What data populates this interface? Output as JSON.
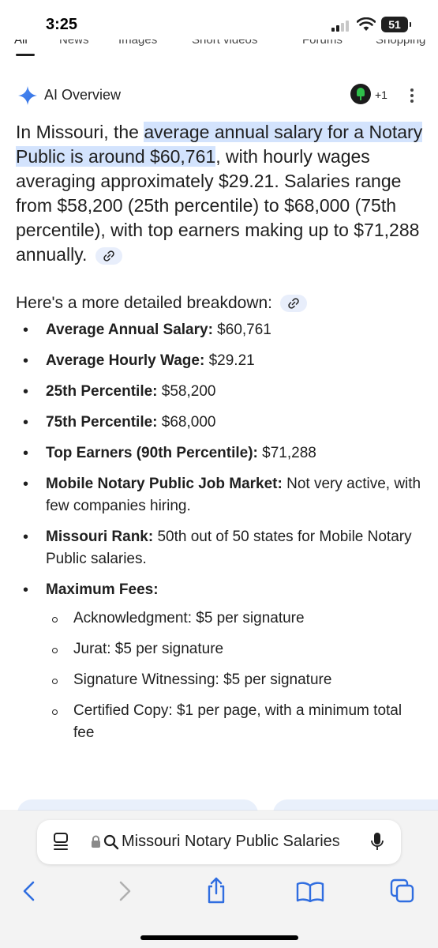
{
  "status_bar": {
    "time": "3:25",
    "battery": "51"
  },
  "search_tabs": [
    "All",
    "News",
    "Images",
    "Short videos",
    "Forums",
    "Shopping"
  ],
  "ai_overview": {
    "title": "AI Overview",
    "contributors": "+1",
    "summary": {
      "pre": "In Missouri, the ",
      "highlight": "average annual salary for a Notary Public is around $60,761",
      "post": ", with hourly wages averaging approximately $29.21. Salaries range from $58,200 (25th percentile) to $68,000 (75th percentile), with top earners making up to $71,288 annually."
    },
    "breakdown_heading": "Here's a more detailed breakdown:",
    "items": [
      {
        "label": "Average Annual Salary:",
        "value": " $60,761"
      },
      {
        "label": "Average Hourly Wage:",
        "value": " $29.21"
      },
      {
        "label": "25th Percentile:",
        "value": " $58,200"
      },
      {
        "label": "75th Percentile:",
        "value": " $68,000"
      },
      {
        "label": "Top Earners (90th Percentile):",
        "value": " $71,288"
      },
      {
        "label": "Mobile Notary Public Job Market:",
        "value": " Not very active, with few companies hiring."
      },
      {
        "label": "Missouri Rank:",
        "value": " 50th out of 50 states for Mobile Notary Public salaries."
      },
      {
        "label": "Maximum Fees:",
        "value": ""
      }
    ],
    "fees": [
      "Acknowledgment: $5 per signature",
      "Jurat: $5 per signature",
      "Signature Witnessing: $5 per signature",
      "Certified Copy: $1 per page, with a minimum total fee"
    ]
  },
  "browser": {
    "address": "Missouri Notary Public Salaries"
  }
}
